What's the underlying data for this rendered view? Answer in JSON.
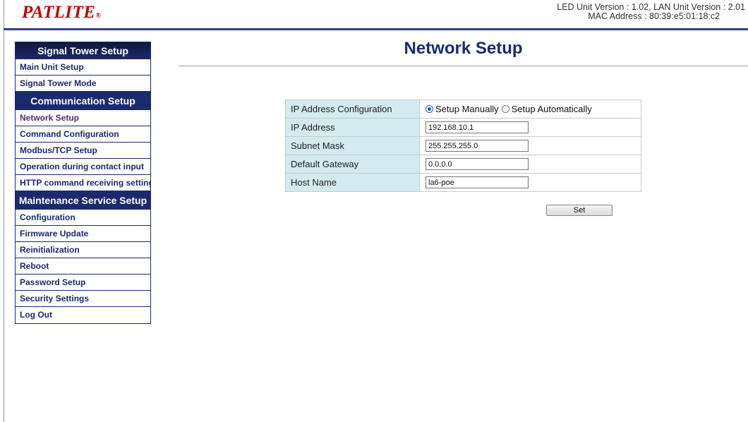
{
  "header": {
    "logo_text": "PATLITE",
    "logo_mark": "®",
    "version_line1": "LED Unit Version : 1.02, LAN Unit Version : 2.01",
    "version_line2": "MAC Address : 80:39:e5:01:18:c2",
    "accent_color": "#1b2a6e",
    "logo_color": "#c00000"
  },
  "sidebar": {
    "sections": [
      {
        "title": "Signal Tower Setup",
        "items": [
          "Main Unit Setup",
          "Signal Tower Mode"
        ]
      },
      {
        "title": "Communication Setup",
        "items": [
          "Network Setup",
          "Command Configuration",
          "Modbus/TCP Setup",
          "Operation during contact input",
          "HTTP command receiving settings"
        ]
      },
      {
        "title": "Maintenance Service Setup",
        "items": [
          "Configuration",
          "Firmware Update",
          "Reinitialization",
          "Reboot",
          "Password Setup",
          "Security Settings",
          "Log Out"
        ]
      }
    ],
    "active_item": "Network Setup"
  },
  "main": {
    "title": "Network Setup",
    "form": {
      "ip_config_label": "IP Address Configuration",
      "ip_config_options": [
        "Setup Manually",
        "Setup Automatically"
      ],
      "ip_config_selected": "Setup Manually",
      "ip_address_label": "IP Address",
      "ip_address_value": "192.168.10.1",
      "subnet_mask_label": "Subnet Mask",
      "subnet_mask_value": "255.255.255.0",
      "default_gateway_label": "Default Gateway",
      "default_gateway_value": "0.0.0.0",
      "host_name_label": "Host Name",
      "host_name_value": "la6-poe"
    },
    "set_button": "Set"
  },
  "icons": {
    "radio_selected": "radio-selected-icon",
    "radio_unselected": "radio-unselected-icon"
  }
}
